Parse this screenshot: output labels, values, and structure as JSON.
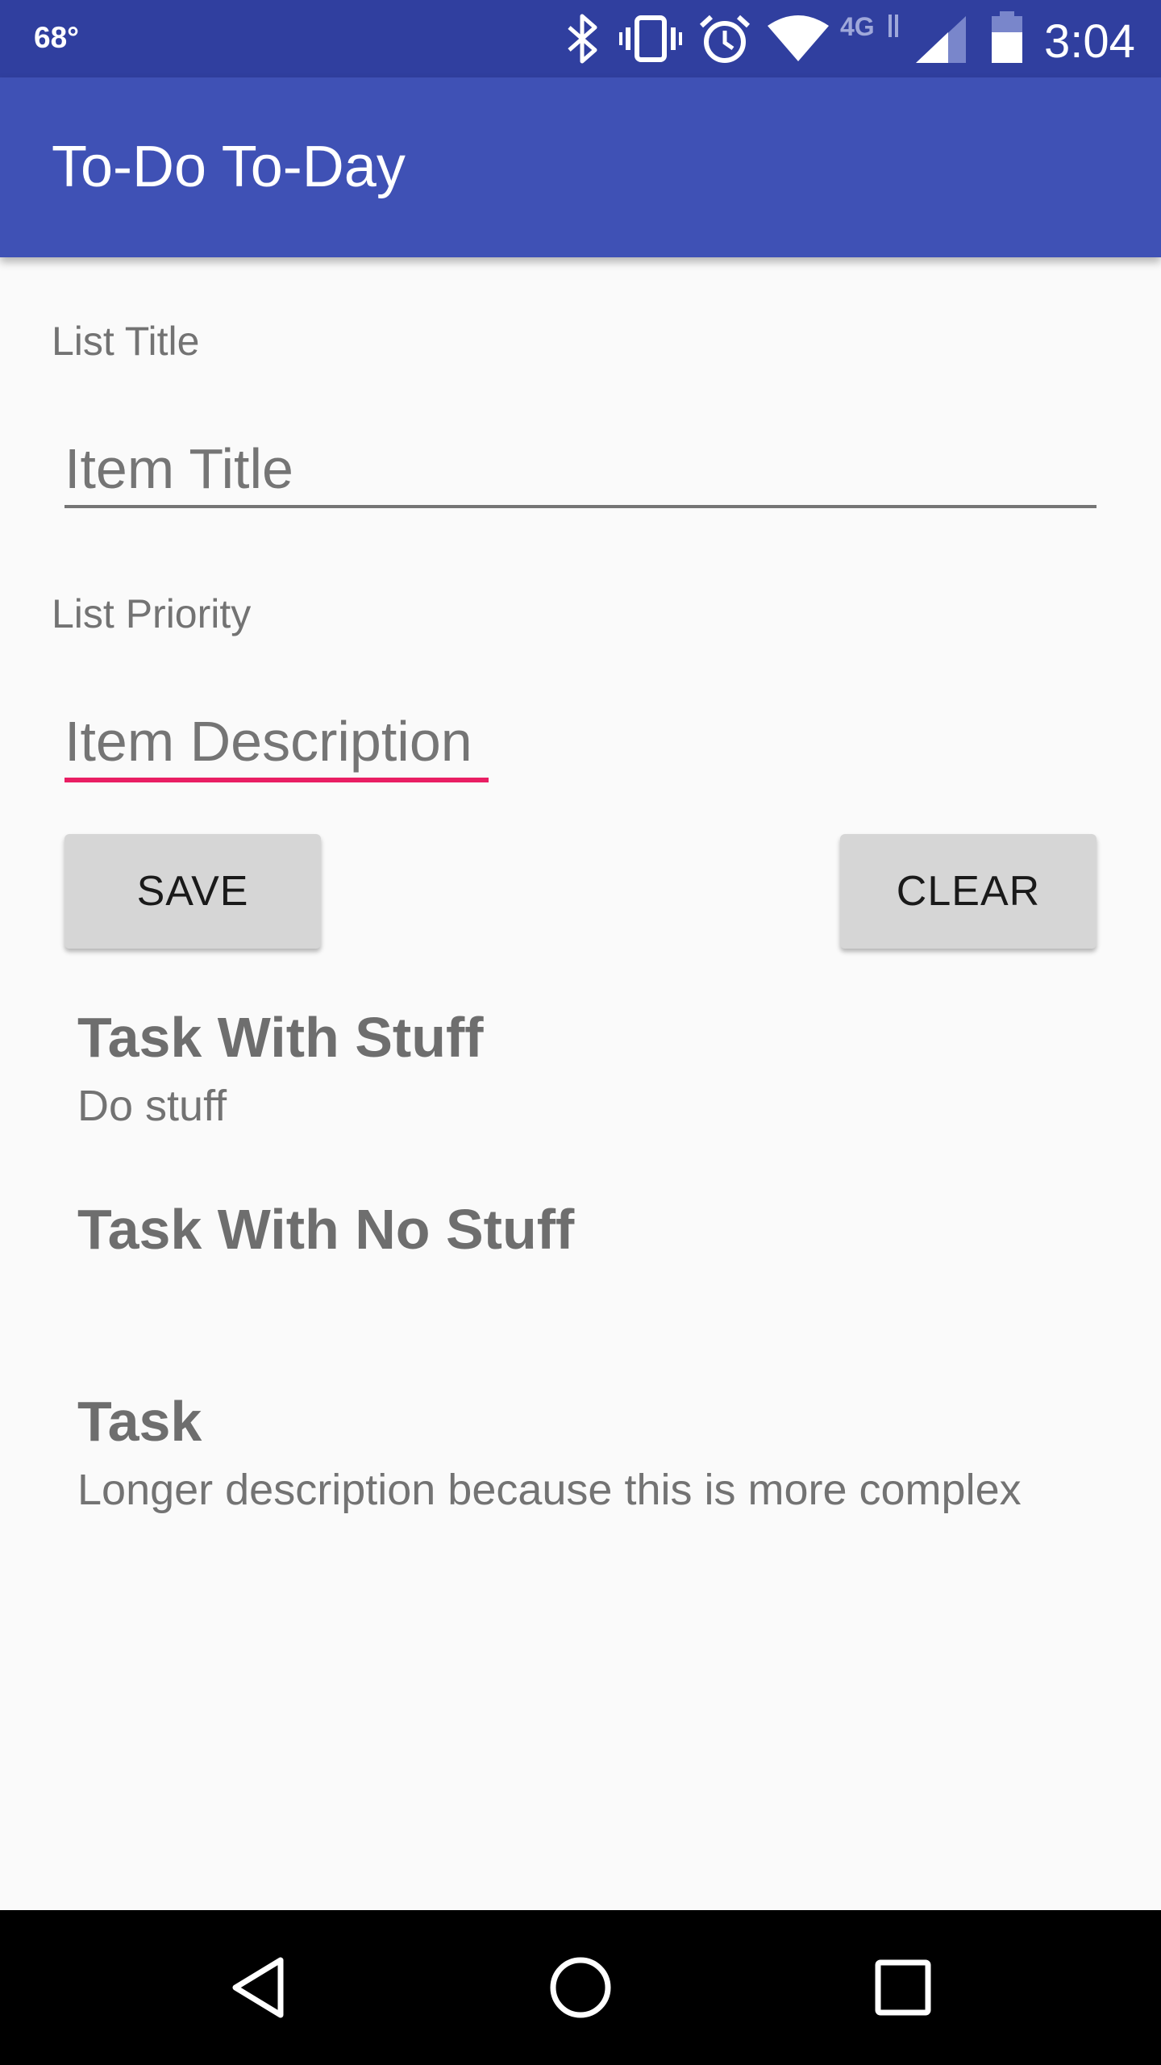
{
  "status_bar": {
    "temperature": "68°",
    "network": "4G",
    "time": "3:04",
    "icons": [
      "bluetooth-icon",
      "vibrate-icon",
      "alarm-icon",
      "wifi-icon",
      "4g-lte-icon",
      "cell-signal-icon",
      "battery-icon"
    ]
  },
  "app_bar": {
    "title": "To-Do To-Day"
  },
  "form": {
    "title_label": "List Title",
    "title_placeholder": "Item Title",
    "priority_label": "List Priority",
    "description_placeholder": "Item Description",
    "save_label": "SAVE",
    "clear_label": "CLEAR"
  },
  "tasks": [
    {
      "title": "Task With Stuff",
      "description": "Do stuff"
    },
    {
      "title": "Task With No Stuff",
      "description": ""
    },
    {
      "title": "Task",
      "description": "Longer description because this is more complex"
    }
  ],
  "nav_bar": {
    "icons": [
      "back-icon",
      "home-icon",
      "recents-icon"
    ]
  },
  "colors": {
    "status_bar": "#303f9f",
    "app_bar": "#3f51b5",
    "focus_accent": "#e91e63",
    "button": "#d6d6d6"
  }
}
